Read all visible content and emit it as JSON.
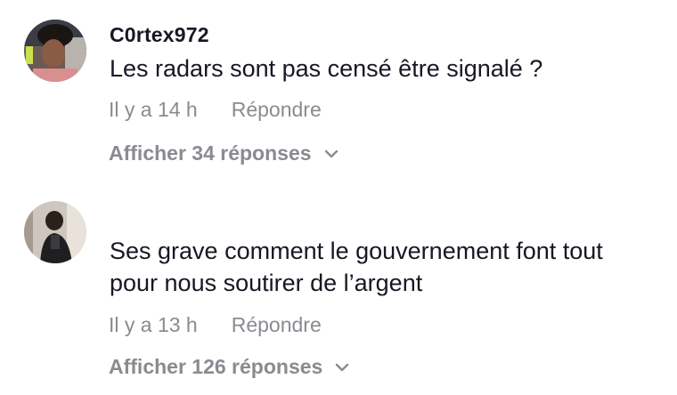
{
  "comments": [
    {
      "username": "C0rtex972",
      "text": "Les radars sont pas censé être signalé ?",
      "time": "Il y a 14 h",
      "reply_label": "Répondre",
      "view_replies_label": "Afficher 34 réponses"
    },
    {
      "username": "",
      "text_lines": [
        "Ses grave comment le gouvernement font tout",
        "pour nous soutirer de l’argent"
      ],
      "time": "Il y a 13 h",
      "reply_label": "Répondre",
      "view_replies_label": "Afficher 126 réponses"
    }
  ],
  "colors": {
    "text_primary": "#161823",
    "text_secondary": "#8a8b91",
    "background": "#ffffff"
  },
  "icons": [
    "chevron-down-icon",
    "avatar"
  ]
}
